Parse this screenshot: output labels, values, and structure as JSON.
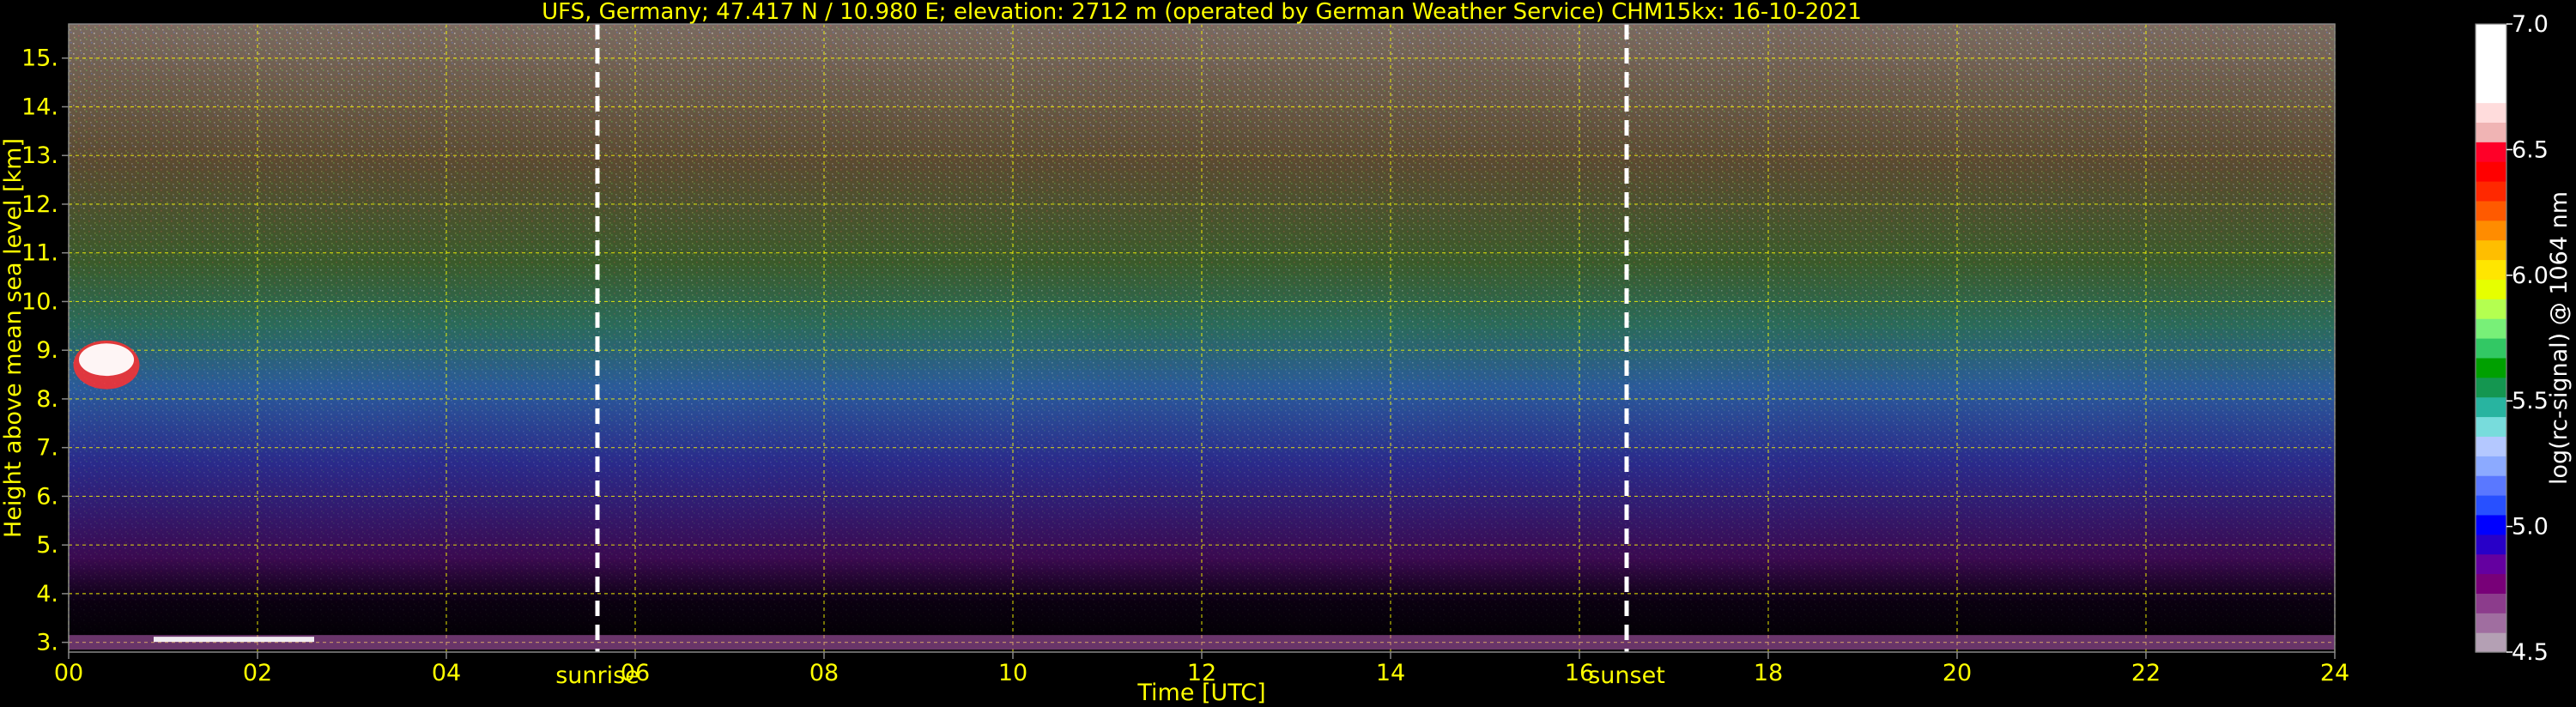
{
  "chart_data": {
    "type": "heatmap",
    "title": "UFS, Germany; 47.417 N / 10.980 E; elevation: 2712 m  (operated by German Weather Service)    CHM15kx: 16-10-2021",
    "xlabel": "Time [UTC]",
    "ylabel": "Height above mean sea level [km]",
    "xlim": [
      0,
      24
    ],
    "ylim": [
      2.8,
      15.7
    ],
    "x_ticks": [
      "00",
      "02",
      "04",
      "06",
      "08",
      "10",
      "12",
      "14",
      "16",
      "18",
      "20",
      "22",
      "24"
    ],
    "y_ticks": [
      "3.",
      "4.",
      "5.",
      "6.",
      "7.",
      "8.",
      "9.",
      "10.",
      "11.",
      "12.",
      "13.",
      "14.",
      "15."
    ],
    "grid": true,
    "grid_color": "#ffff00",
    "text_color": "#ffff00",
    "vlines": [
      {
        "label": "sunrise",
        "x": 5.6
      },
      {
        "label": "sunset",
        "x": 16.5
      }
    ],
    "colorbar": {
      "label": "log(rc-signal) @ 1064 nm",
      "range": [
        4.5,
        7.0
      ],
      "ticks": [
        "4.5",
        "5.0",
        "5.5",
        "6.0",
        "6.5",
        "7.0"
      ],
      "colors": [
        "#b4a0b4",
        "#a06ea0",
        "#8c3c8c",
        "#780078",
        "#6400a0",
        "#2800c8",
        "#0000ff",
        "#2850ff",
        "#5a78ff",
        "#8caaff",
        "#b4c8ff",
        "#78dcdc",
        "#28b4a0",
        "#149650",
        "#00a000",
        "#32c864",
        "#78f078",
        "#b4ff50",
        "#e6ff00",
        "#ffe600",
        "#ffbe00",
        "#ff8c00",
        "#ff5a00",
        "#ff2800",
        "#ff0000",
        "#ff0028",
        "#f0b4b4",
        "#ffdcdc",
        "#ffffff",
        "#ffffff",
        "#ffffff",
        "#ffffff"
      ]
    },
    "features": [
      {
        "name": "cloud",
        "x": [
          0.05,
          0.75
        ],
        "y": [
          8.2,
          9.2
        ]
      },
      {
        "name": "surface-layer",
        "x": [
          0.0,
          24.0
        ],
        "y": [
          2.85,
          3.15
        ]
      }
    ]
  }
}
